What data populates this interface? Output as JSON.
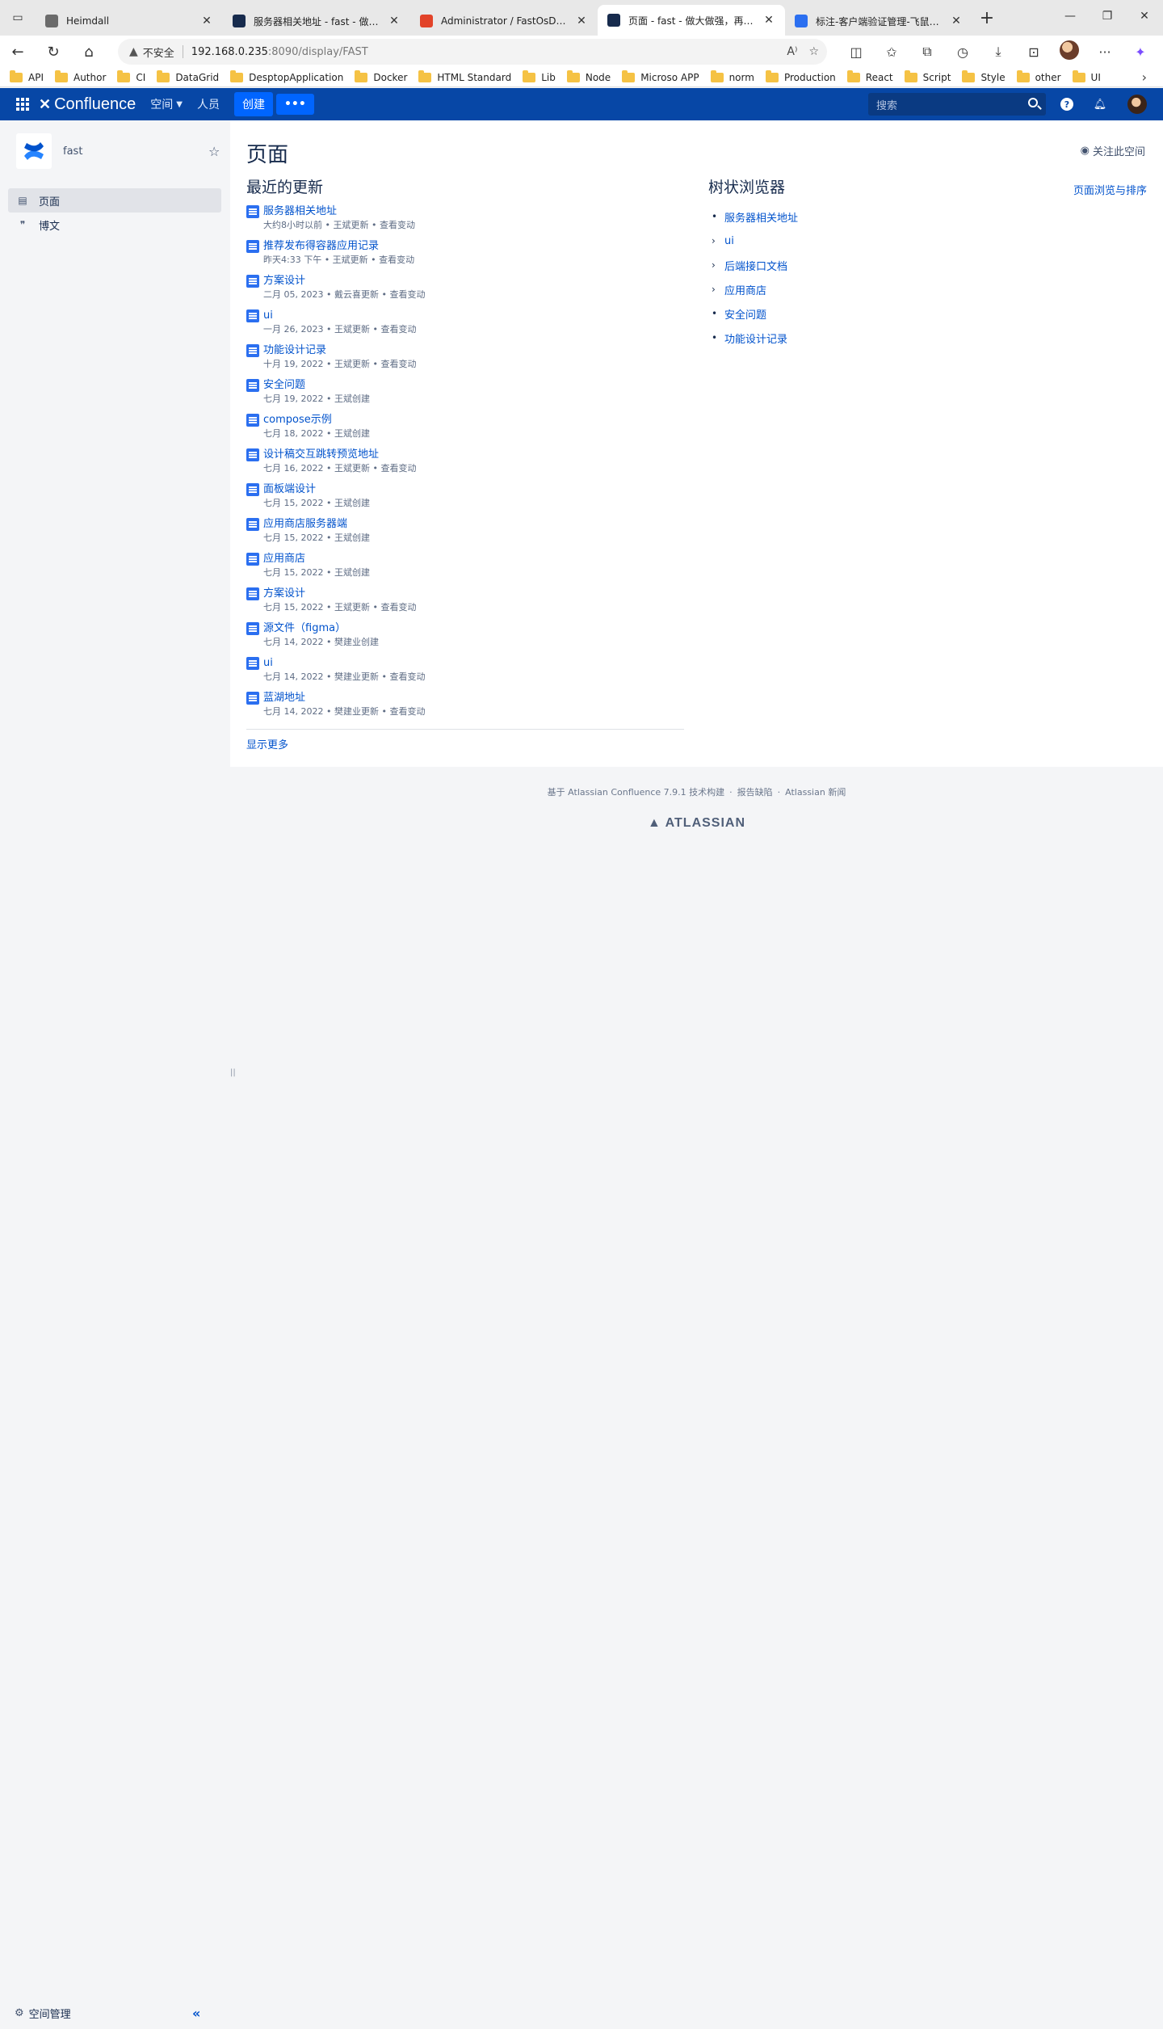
{
  "browser": {
    "tabs": [
      {
        "title": "Heimdall",
        "favicon_color": "#6b6b6b"
      },
      {
        "title": "服务器相关地址 - fast - 做大做强",
        "favicon_color": "#172b4d"
      },
      {
        "title": "Administrator / FastOsDockerw",
        "favicon_color": "#e24329"
      },
      {
        "title": "页面 - fast - 做大做强，再创辉煌",
        "favicon_color": "#172b4d"
      },
      {
        "title": "标注-客户端验证管理-飞鼠1.0 -",
        "favicon_color": "#2b6ff0"
      }
    ],
    "active_tab": 3,
    "insecure_label": "不安全",
    "url_host": "192.168.0.235",
    "url_path": ":8090/display/FAST",
    "bookmarks": [
      "API",
      "Author",
      "CI",
      "DataGrid",
      "DesptopApplication",
      "Docker",
      "HTML Standard",
      "Lib",
      "Node",
      "Microso APP",
      "norm",
      "Production",
      "React",
      "Script",
      "Style",
      "other",
      "UI"
    ]
  },
  "header": {
    "logo": "Confluence",
    "nav_spaces": "空间",
    "nav_people": "人员",
    "create": "创建",
    "more": "•••",
    "search_placeholder": "搜索"
  },
  "sidebar": {
    "space_name": "fast",
    "items": [
      {
        "label": "页面",
        "icon": "page-icon"
      },
      {
        "label": "博文",
        "icon": "quote-icon"
      }
    ],
    "space_admin": "空间管理"
  },
  "main": {
    "title": "页面",
    "watch": "关注此空间",
    "recent_heading": "最近的更新",
    "updates": [
      {
        "title": "服务器相关地址",
        "meta": "大约8小时以前 • 王斌更新 • 查看变动"
      },
      {
        "title": "推荐发布得容器应用记录",
        "meta": "昨天4:33 下午 • 王斌更新 • 查看变动"
      },
      {
        "title": "方案设计",
        "meta": "二月 05, 2023 • 戴云喜更新 • 查看变动"
      },
      {
        "title": "ui",
        "meta": "一月 26, 2023 • 王斌更新 • 查看变动"
      },
      {
        "title": "功能设计记录",
        "meta": "十月 19, 2022 • 王斌更新 • 查看变动"
      },
      {
        "title": "安全问题",
        "meta": "七月 19, 2022 • 王斌创建"
      },
      {
        "title": "compose示例",
        "meta": "七月 18, 2022 • 王斌创建"
      },
      {
        "title": "设计稿交互跳转预览地址",
        "meta": "七月 16, 2022 • 王斌更新 • 查看变动"
      },
      {
        "title": "面板端设计",
        "meta": "七月 15, 2022 • 王斌创建"
      },
      {
        "title": "应用商店服务器端",
        "meta": "七月 15, 2022 • 王斌创建"
      },
      {
        "title": "应用商店",
        "meta": "七月 15, 2022 • 王斌创建"
      },
      {
        "title": "方案设计",
        "meta": "七月 15, 2022 • 王斌更新 • 查看变动"
      },
      {
        "title": "源文件（figma）",
        "meta": "七月 14, 2022 • 樊建业创建"
      },
      {
        "title": "ui",
        "meta": "七月 14, 2022 • 樊建业更新 • 查看变动"
      },
      {
        "title": "蓝湖地址",
        "meta": "七月 14, 2022 • 樊建业更新 • 查看变动"
      }
    ],
    "show_more": "显示更多",
    "tree_heading": "树状浏览器",
    "tree_link": "页面浏览与排序",
    "tree": [
      {
        "label": "服务器相关地址",
        "marker": "•"
      },
      {
        "label": "ui",
        "marker": "›"
      },
      {
        "label": "后端接口文档",
        "marker": "›"
      },
      {
        "label": "应用商店",
        "marker": "›"
      },
      {
        "label": "安全问题",
        "marker": "•"
      },
      {
        "label": "功能设计记录",
        "marker": "•"
      }
    ]
  },
  "footer": {
    "built_on": "基于 Atlassian Confluence 7.9.1 技术构建",
    "report": "报告缺陷",
    "news": "Atlassian 新闻",
    "brand": "ATLASSIAN"
  },
  "colors": {
    "header_bg": "#0747a6",
    "link": "#0052cc",
    "create_btn": "#0065ff"
  }
}
